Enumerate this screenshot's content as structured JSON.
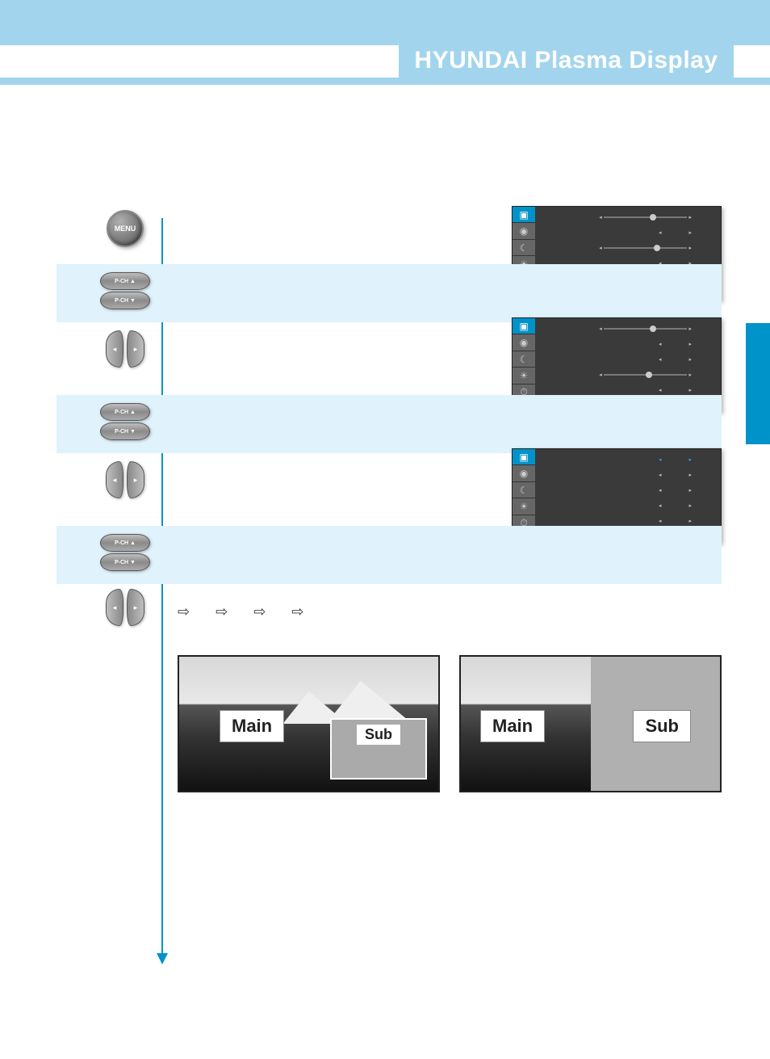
{
  "header": {
    "brand": "HYUNDAI Plasma Display"
  },
  "buttons": {
    "menu": "MENU",
    "pch_up": "P-CH ▲",
    "pch_down": "P-CH ▼"
  },
  "osd_footer": [
    "◆",
    "◆",
    "■"
  ],
  "osd_icons": [
    "▣",
    "◉",
    "☾",
    "☀",
    "⏱"
  ],
  "osd_menus": [
    {
      "selected": 0,
      "rows": [
        {
          "label": "",
          "type": "slider",
          "knob": 55
        },
        {
          "label": "",
          "type": "arrows"
        },
        {
          "label": "",
          "type": "slider",
          "knob": 60
        },
        {
          "label": "",
          "type": "arrows"
        },
        {
          "label": "",
          "type": "arrows"
        }
      ]
    },
    {
      "selected": 0,
      "rows": [
        {
          "label": "",
          "type": "slider",
          "knob": 55
        },
        {
          "label": "",
          "type": "arrows"
        },
        {
          "label": "",
          "type": "arrows"
        },
        {
          "label": "",
          "type": "slider",
          "knob": 50
        },
        {
          "label": "",
          "type": "arrows"
        }
      ]
    },
    {
      "selected": 0,
      "rows": [
        {
          "label": "",
          "type": "arrows",
          "hl": true
        },
        {
          "label": "",
          "type": "arrows"
        },
        {
          "label": "",
          "type": "arrows"
        },
        {
          "label": "",
          "type": "arrows"
        },
        {
          "label": "",
          "type": "arrows"
        }
      ]
    }
  ],
  "sequence_arrows": [
    "⇨",
    "⇨",
    "⇨",
    "⇨"
  ],
  "preview_labels": {
    "main": "Main",
    "sub": "Sub"
  },
  "page_number": ""
}
